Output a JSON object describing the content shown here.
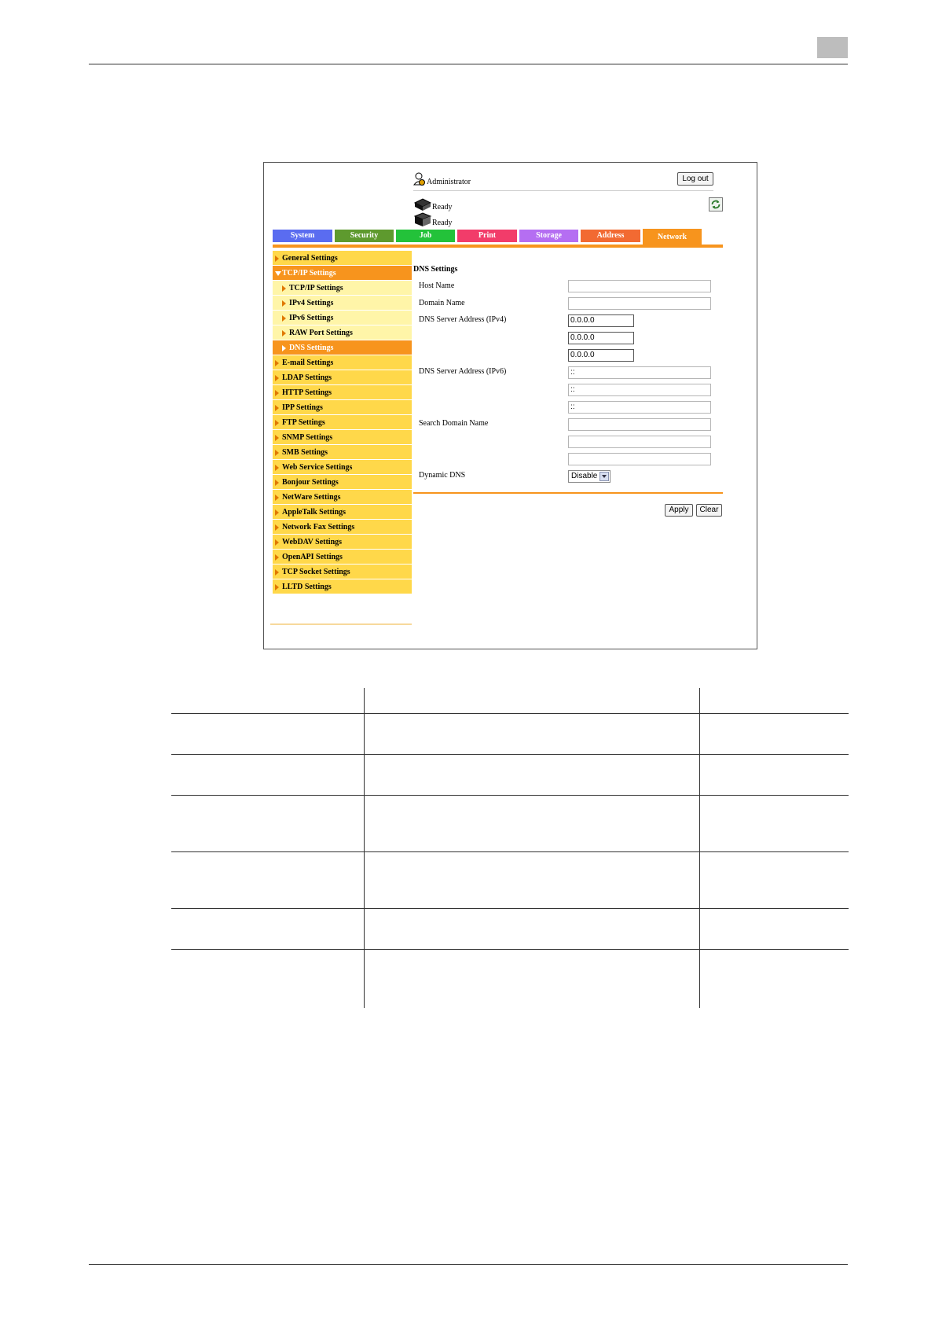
{
  "header": {
    "admin_label": "Administrator",
    "logout_label": "Log out"
  },
  "status": [
    {
      "label": "Ready"
    },
    {
      "label": "Ready"
    }
  ],
  "tabs": [
    {
      "label": "System",
      "color": "#5a6cf0"
    },
    {
      "label": "Security",
      "color": "#5e9a2e"
    },
    {
      "label": "Job",
      "color": "#23c23a"
    },
    {
      "label": "Print",
      "color": "#f23c6a"
    },
    {
      "label": "Storage",
      "color": "#b56ef2"
    },
    {
      "label": "Address",
      "color": "#f26a32"
    },
    {
      "label": "Network",
      "color": "#f7941d",
      "active": true
    }
  ],
  "sidebar": {
    "items": [
      {
        "label": "General Settings"
      },
      {
        "label": "TCP/IP Settings"
      },
      {
        "label": "TCP/IP Settings"
      },
      {
        "label": "IPv4 Settings"
      },
      {
        "label": "IPv6 Settings"
      },
      {
        "label": "RAW Port Settings"
      },
      {
        "label": "DNS Settings"
      },
      {
        "label": "E-mail Settings"
      },
      {
        "label": "LDAP Settings"
      },
      {
        "label": "HTTP Settings"
      },
      {
        "label": "IPP Settings"
      },
      {
        "label": "FTP Settings"
      },
      {
        "label": "SNMP Settings"
      },
      {
        "label": "SMB Settings"
      },
      {
        "label": "Web Service Settings"
      },
      {
        "label": "Bonjour Settings"
      },
      {
        "label": "NetWare Settings"
      },
      {
        "label": "AppleTalk Settings"
      },
      {
        "label": "Network Fax Settings"
      },
      {
        "label": "WebDAV Settings"
      },
      {
        "label": "OpenAPI Settings"
      },
      {
        "label": "TCP Socket Settings"
      },
      {
        "label": "LLTD Settings"
      }
    ]
  },
  "form": {
    "title": "DNS Settings",
    "host_name_label": "Host Name",
    "host_name_value": "",
    "domain_name_label": "Domain Name",
    "domain_name_value": "",
    "dns_ipv4_label": "DNS Server Address (IPv4)",
    "dns_ipv4_values": [
      "0.0.0.0",
      "0.0.0.0",
      "0.0.0.0"
    ],
    "dns_ipv6_label": "DNS Server Address (IPv6)",
    "dns_ipv6_values": [
      "::",
      "::",
      "::"
    ],
    "search_domain_label": "Search Domain Name",
    "search_domain_values": [
      "",
      "",
      ""
    ],
    "dynamic_dns_label": "Dynamic DNS",
    "dynamic_dns_value": "Disable",
    "apply_label": "Apply",
    "clear_label": "Clear"
  }
}
